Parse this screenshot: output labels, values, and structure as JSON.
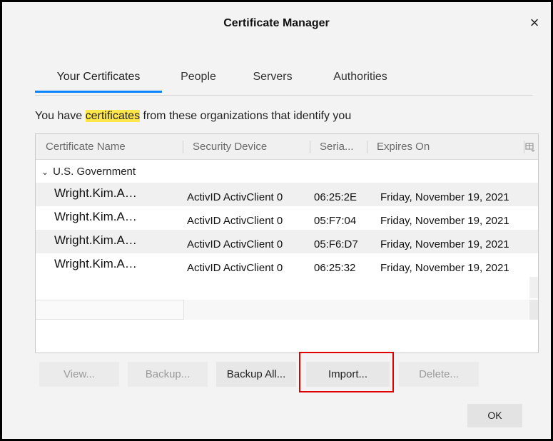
{
  "window": {
    "title": "Certificate Manager",
    "close_glyph": "×"
  },
  "tabs": [
    {
      "label": "Your Certificates",
      "active": true
    },
    {
      "label": "People",
      "active": false
    },
    {
      "label": "Servers",
      "active": false
    },
    {
      "label": "Authorities",
      "active": false
    }
  ],
  "intro": {
    "before": "You have ",
    "highlight": "certificates",
    "after": " from these organizations that identify you"
  },
  "table": {
    "columns": [
      "Certificate Name",
      "Security Device",
      "Seria...",
      "Expires On"
    ],
    "column_picker_icon": "column-picker-icon",
    "group": {
      "expand_glyph": "⌄",
      "label": "U.S. Government"
    },
    "rows": [
      {
        "name": "Wright.Kim.A…",
        "device": "ActivID ActivClient 0",
        "serial": "06:25:2E",
        "expires": "Friday, November 19, 2021"
      },
      {
        "name": "Wright.Kim.A…",
        "device": "ActivID ActivClient 0",
        "serial": "05:F7:04",
        "expires": "Friday, November 19, 2021"
      },
      {
        "name": "Wright.Kim.A…",
        "device": "ActivID ActivClient 0",
        "serial": "05:F6:D7",
        "expires": "Friday, November 19, 2021"
      },
      {
        "name": "Wright.Kim.A…",
        "device": "ActivID ActivClient 0",
        "serial": "06:25:32",
        "expires": "Friday, November 19, 2021"
      }
    ]
  },
  "buttons": {
    "view": {
      "label": "View...",
      "enabled": false
    },
    "backup": {
      "label": "Backup...",
      "enabled": false
    },
    "backup_all": {
      "label": "Backup All...",
      "enabled": true
    },
    "import": {
      "label": "Import...",
      "enabled": true
    },
    "delete": {
      "label": "Delete...",
      "enabled": false
    },
    "ok": {
      "label": "OK"
    }
  },
  "colors": {
    "accent": "#0a84ff",
    "highlight": "#ffe64a",
    "annotation": "#e00000"
  }
}
